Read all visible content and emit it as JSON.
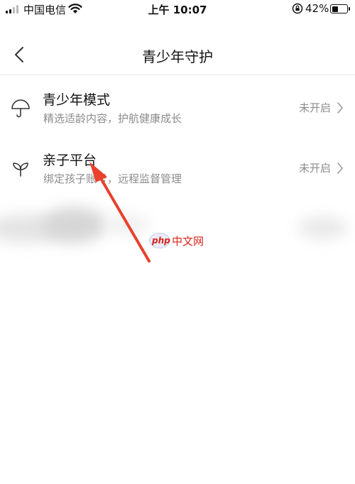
{
  "status_bar": {
    "carrier": "中国电信",
    "time": "上午 10:07",
    "battery_percent": "42%",
    "battery_level": 0.42
  },
  "nav": {
    "title": "青少年守护",
    "back_icon": "chevron-left-icon"
  },
  "items": [
    {
      "title": "青少年模式",
      "subtitle": "精选适龄内容，护航健康成长",
      "status": "未开启",
      "icon": "umbrella-icon"
    },
    {
      "title": "亲子平台",
      "subtitle": "绑定孩子账号，远程监督管理",
      "status": "未开启",
      "icon": "sprout-icon"
    }
  ],
  "watermark": {
    "badge": "php",
    "text": "中文网"
  },
  "colors": {
    "accent_arrow": "#e8412c",
    "secondary_text": "#8c8c8c",
    "divider": "#ececec"
  }
}
